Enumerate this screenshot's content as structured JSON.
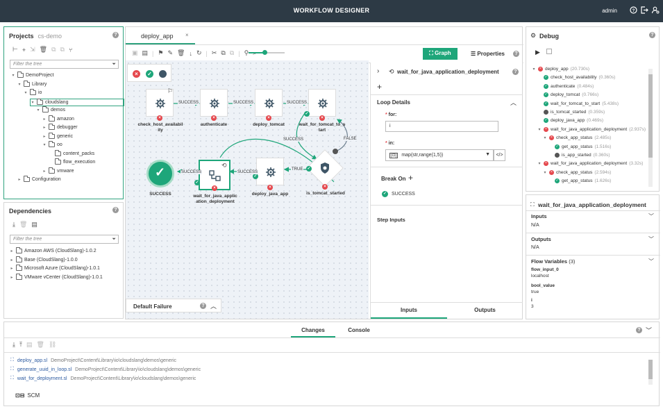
{
  "app": {
    "title": "WORKFLOW DESIGNER",
    "user": "admin"
  },
  "projects": {
    "title": "Projects",
    "subtitle": "cs-demo",
    "filter_placeholder": "Filter the tree",
    "tree": [
      "DemoProject",
      "Library",
      "io",
      "cloudslang",
      "demos",
      "amazon",
      "debugger",
      "generic",
      "oo",
      "content_packs",
      "flow_execution",
      "vmware",
      "Configuration"
    ]
  },
  "dependencies": {
    "title": "Dependencies",
    "filter_placeholder": "Filter the tree",
    "items": [
      "Amazon AWS (CloudSlang)-1.0.2",
      "Base (CloudSlang)-1.0.0",
      "Microsoft Azure (CloudSlang)-1.0.1",
      "VMware vCenter (CloudSlang)-1.0.1"
    ]
  },
  "editor": {
    "tab": "deploy_app",
    "graph_button": "Graph",
    "properties_button": "Properties",
    "default_failure": "Default Failure",
    "nodes": {
      "check_host": "check_host_availabil\nity",
      "authenticate": "authenticate",
      "deploy_tomcat": "deploy_tomcat",
      "wait_tomcat": "wait_for_tomcat_to_s\ntart",
      "success": "SUCCESS",
      "wait_java": "wait_for_java_applic\nation_deployment",
      "deploy_java": "deploy_java_app",
      "is_tomcat": "is_tomcat_started"
    },
    "edges": {
      "e1": "SUCCESS",
      "e2": "SUCCESS",
      "e3": "SUCCESS",
      "e4": "SUCCESS",
      "e5": "FALSE",
      "e6": "TRUE",
      "e7": "SUCCESS",
      "e8": "SUCCESS"
    }
  },
  "properties": {
    "step_title": "wait_for_java_application_deployment",
    "loop_details": "Loop Details",
    "for_label": "for:",
    "for_value": "i",
    "in_label": "in:",
    "in_value": "map(str,range(1,5))",
    "break_on": "Break On",
    "break_value": "SUCCESS",
    "step_inputs": "Step Inputs",
    "tab_inputs": "Inputs",
    "tab_outputs": "Outputs"
  },
  "debug": {
    "title": "Debug",
    "items": [
      {
        "name": "deploy_app",
        "time": "(20.730s)",
        "status": "x"
      },
      {
        "name": "check_host_availability",
        "time": "(0.360s)",
        "status": "ok"
      },
      {
        "name": "authenticate",
        "time": "(0.484s)",
        "status": "ok"
      },
      {
        "name": "deploy_tomcat",
        "time": "(0.766s)",
        "status": "ok"
      },
      {
        "name": "wait_for_tomcat_to_start",
        "time": "(5.438s)",
        "status": "ok"
      },
      {
        "name": "is_tomcat_started",
        "time": "(0.359s)",
        "status": "b"
      },
      {
        "name": "deploy_java_app",
        "time": "(0.469s)",
        "status": "ok"
      },
      {
        "name": "wait_for_java_application_deployment",
        "time": "(2.937s)",
        "status": "x"
      },
      {
        "name": "check_app_status",
        "time": "(2.485s)",
        "status": "x"
      },
      {
        "name": "get_app_status",
        "time": "(1.516s)",
        "status": "ok"
      },
      {
        "name": "is_app_started",
        "time": "(0.360s)",
        "status": "b"
      },
      {
        "name": "wait_for_java_application_deployment",
        "time": "(3.32s)",
        "status": "x"
      },
      {
        "name": "check_app_status",
        "time": "(2.594s)",
        "status": "x"
      },
      {
        "name": "get_app_status",
        "time": "(1.626s)",
        "status": "ok"
      }
    ]
  },
  "step_info": {
    "title": "wait_for_java_application_deployment",
    "inputs_label": "Inputs",
    "inputs_value": "N/A",
    "outputs_label": "Outputs",
    "outputs_value": "N/A",
    "flow_vars_label": "Flow Variables",
    "flow_vars_count": "(3)",
    "vars": [
      {
        "name": "flow_input_0",
        "value": "localhost"
      },
      {
        "name": "bool_value",
        "value": "true"
      },
      {
        "name": "i",
        "value": "3"
      }
    ]
  },
  "bottom": {
    "tab_changes": "Changes",
    "tab_console": "Console",
    "files": [
      {
        "name": "deploy_app.sl",
        "path": "DemoProject\\Content\\Library\\io\\cloudslang\\demos\\generic"
      },
      {
        "name": "generate_uuid_in_loop.sl",
        "path": "DemoProject\\Content\\Library\\io\\cloudslang\\demos\\generic"
      },
      {
        "name": "wait_for_deployment.sl",
        "path": "DemoProject\\Content\\Library\\io\\cloudslang\\demos\\generic"
      }
    ],
    "scm": "SCM"
  }
}
